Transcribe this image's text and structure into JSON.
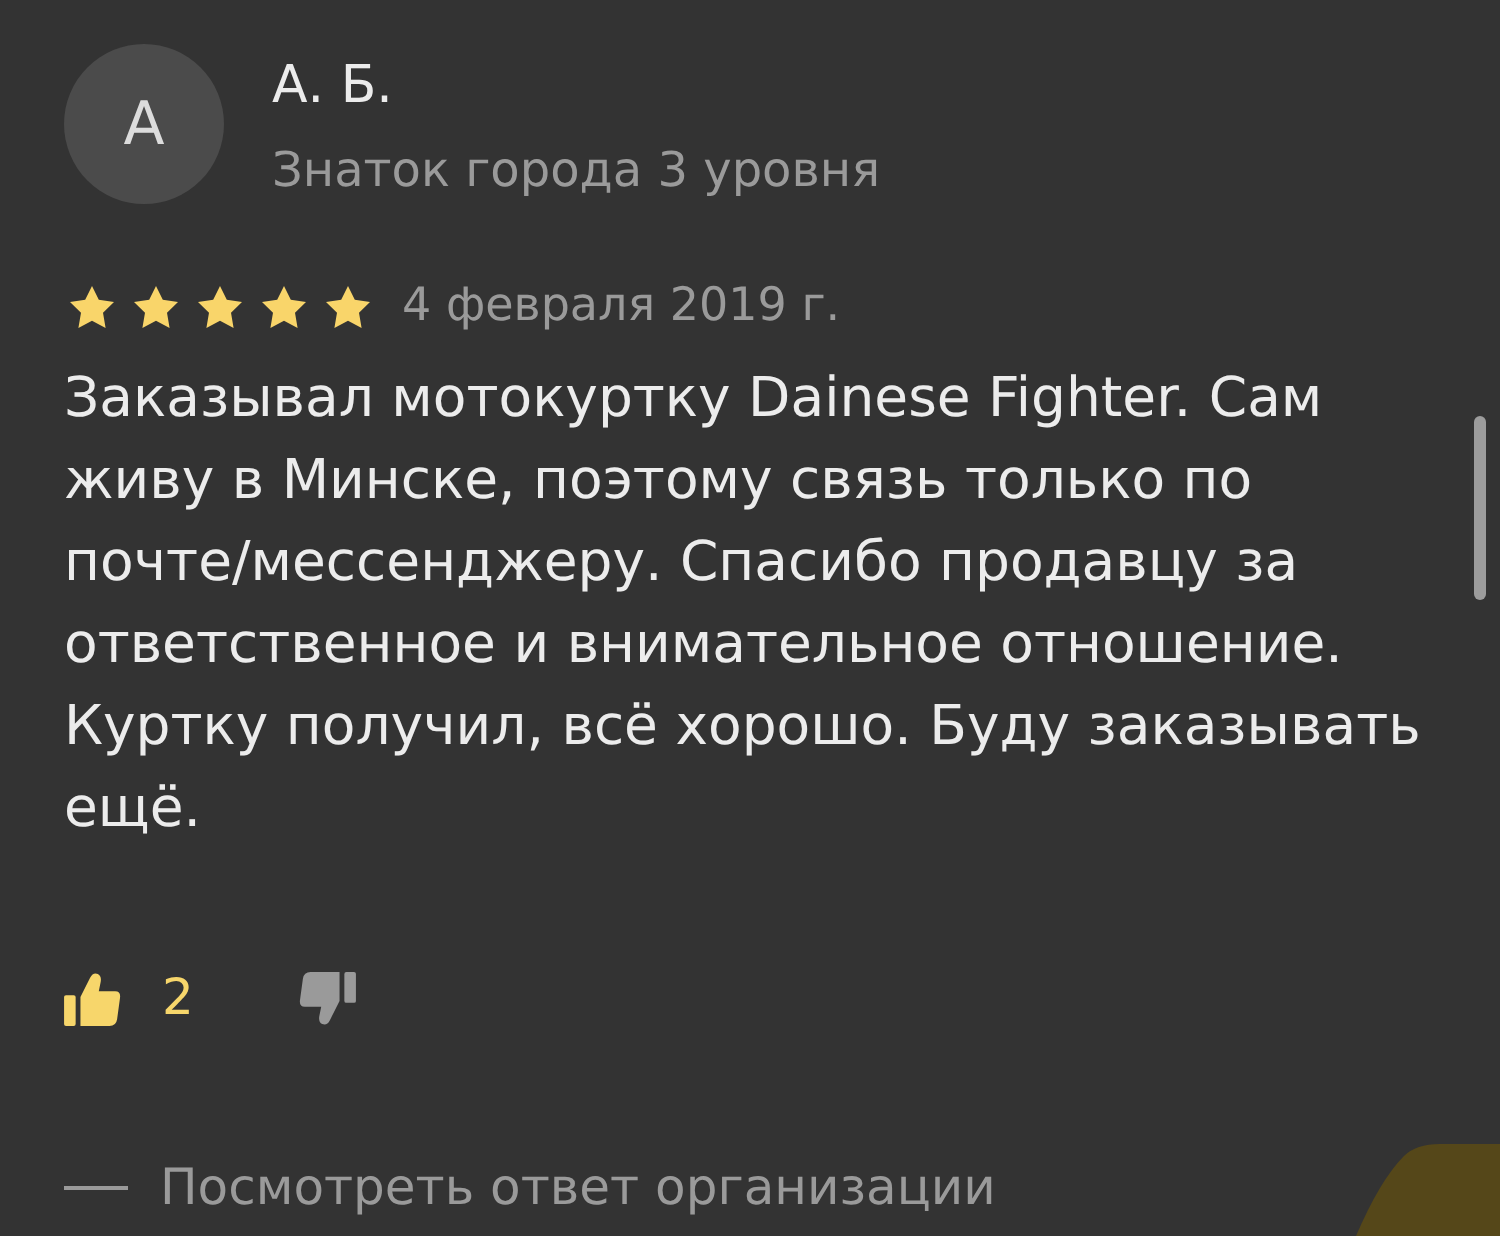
{
  "review": {
    "author": {
      "initial": "А",
      "name": "А. Б.",
      "level": "Знаток города 3 уровня"
    },
    "stars": 5,
    "date": "4 февраля 2019 г.",
    "text": "Заказывал мотокуртку Dainese Fighter. Сам\nживу в Минске, поэтому связь только по\nпочте/мессенджеру. Спасибо продавцу за\nответственное и внимательное отношение.\nКуртку получил, всё хорошо. Буду заказывать\nещё.",
    "reactions": [
      {
        "kind": "like",
        "count": "2",
        "active": true
      },
      {
        "kind": "dislike",
        "active": false
      }
    ]
  },
  "footer": {
    "link": "Посмотреть ответ организации"
  }
}
